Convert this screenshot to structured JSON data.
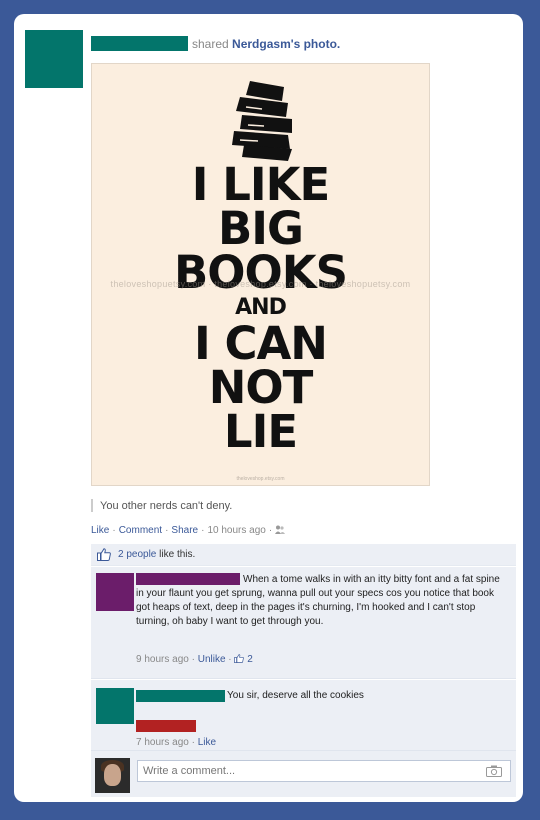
{
  "post": {
    "shared_prefix": "shared",
    "shared_source": "Nerdgasm's photo.",
    "caption": "You other nerds can't deny.",
    "actions": {
      "like": "Like",
      "comment": "Comment",
      "share": "Share",
      "time": "10 hours ago"
    },
    "icons": {
      "audience": "friends-icon"
    }
  },
  "poster": {
    "lines": [
      "I LIKE",
      "BIG",
      "BOOKS",
      "AND",
      "I CAN",
      "NOT",
      "LIE"
    ],
    "watermark": "theloveshopuetsy.com · theloveshop.etsy.com · theloveshopuetsy.com",
    "footer": "theloveshop.etsy.com"
  },
  "likes": {
    "count_text": "2 people",
    "suffix": "like this."
  },
  "comments": [
    {
      "text": "When a tome walks in with an itty bitty font and a fat spine in your flaunt you get sprung, wanna pull out your specs cos you notice that book got heaps of text, deep in the pages it's churning, I'm hooked and I can't stop turning, oh baby I want to get through you.",
      "time": "9 hours ago",
      "action": "Unlike",
      "like_count": "2"
    },
    {
      "text": "You sir, deserve all the cookies",
      "time": "7 hours ago",
      "action": "Like"
    }
  ],
  "composer": {
    "placeholder": "Write a comment..."
  },
  "colors": {
    "background": "#3b5998",
    "link": "#3b5998",
    "censor_teal": "#03756b",
    "censor_purple": "#6b1d6a",
    "censor_red": "#b22222",
    "comment_bg": "#eceff5"
  }
}
